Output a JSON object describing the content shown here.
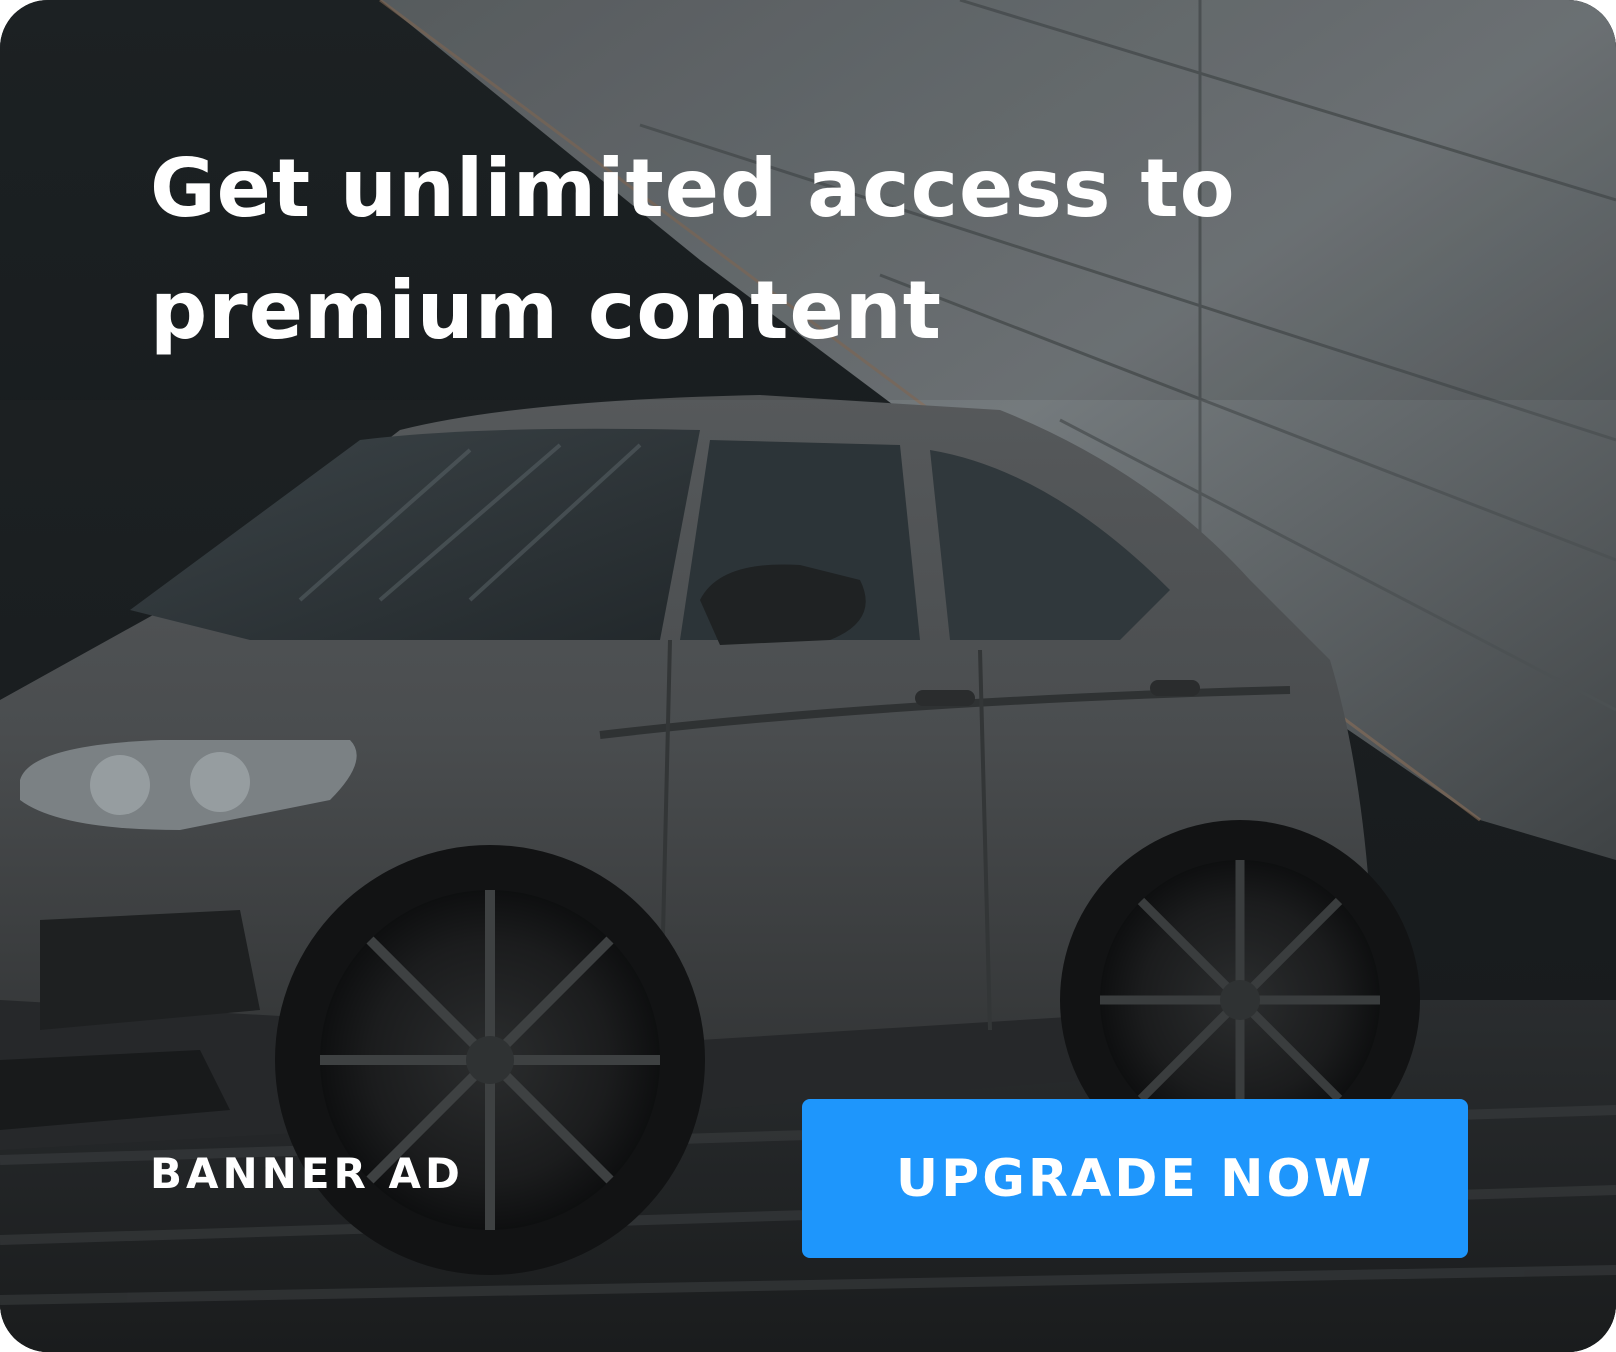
{
  "banner": {
    "headline": "Get unlimited access to premium content",
    "label": "BANNER AD",
    "cta_label": "UPGRADE NOW"
  },
  "colors": {
    "cta_background": "#1e96fc",
    "text": "#ffffff",
    "photo_dark": "#1c1f21",
    "photo_wall": "#6b6f72"
  },
  "image": {
    "subject": "dark matte grey SUV in front of grey panelled wall"
  }
}
